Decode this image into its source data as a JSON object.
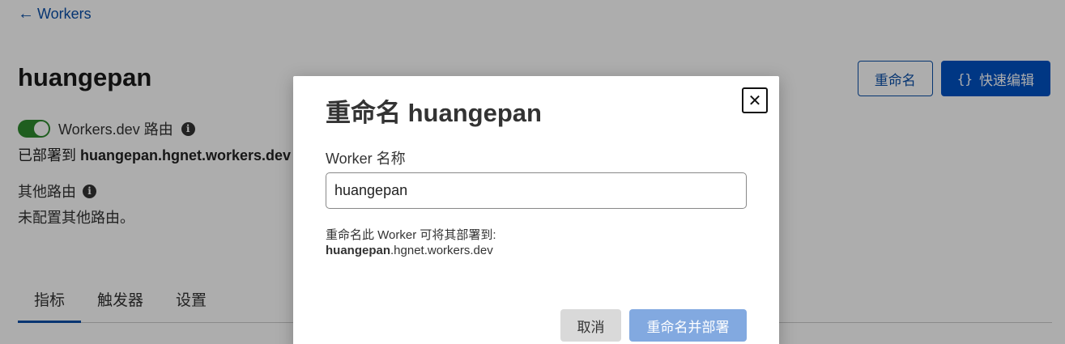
{
  "nav": {
    "back_arrow": "←",
    "back_label": "Workers"
  },
  "worker": {
    "title": "huangepan",
    "rename_label": "重命名",
    "quick_edit_braces": "{}",
    "quick_edit_label": "快速编辑",
    "workers_dev_label": "Workers.dev 路由",
    "workers_dev_enabled": true,
    "deployed_prefix": "已部署到 ",
    "deployed_url": "huangepan.hgnet.workers.dev",
    "other_routes_label": "其他路由",
    "no_routes_text": "未配置其他路由。"
  },
  "tabs": [
    {
      "label": "指标",
      "active": true
    },
    {
      "label": "触发器",
      "active": false
    },
    {
      "label": "设置",
      "active": false
    }
  ],
  "modal": {
    "title": "重命名 huangepan",
    "close_glyph": "✕",
    "field_label": "Worker 名称",
    "input_value": "huangepan",
    "hint": "重命名此 Worker 可将其部署到:",
    "hint_url_bold": "huangepan",
    "hint_url_rest": ".hgnet.workers.dev",
    "cancel_label": "取消",
    "submit_label": "重命名并部署"
  },
  "info_glyph": "i",
  "colors": {
    "accent": "#0051c3",
    "toggle_on": "#2e8b2e",
    "submit_disabled": "#82a9e0"
  }
}
